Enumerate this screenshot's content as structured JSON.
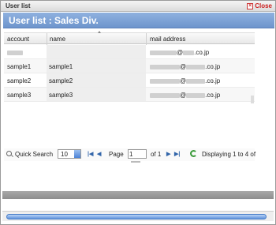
{
  "window": {
    "title": "User list",
    "close_label": "Close"
  },
  "panel": {
    "title": "User list : Sales Div."
  },
  "table": {
    "headers": [
      "account",
      "name",
      "mail address"
    ],
    "rows": [
      {
        "account": "",
        "name": "",
        "mail_visible": "@",
        "mail_domain": ".co.jp"
      },
      {
        "account": "sample1",
        "name": "sample1",
        "mail_visible": "@",
        "mail_domain": ".co.jp"
      },
      {
        "account": "sample2",
        "name": "sample2",
        "mail_visible": "@",
        "mail_domain": ".co.jp"
      },
      {
        "account": "sample3",
        "name": "sample3",
        "mail_visible": "@",
        "mail_domain": ".co.jp"
      }
    ]
  },
  "toolbar": {
    "quick_search": "Quick Search",
    "page_size": "10",
    "page_label": "Page",
    "page_value": "1",
    "of_label": "of 1",
    "status": "Displaying 1 to 4 of"
  }
}
